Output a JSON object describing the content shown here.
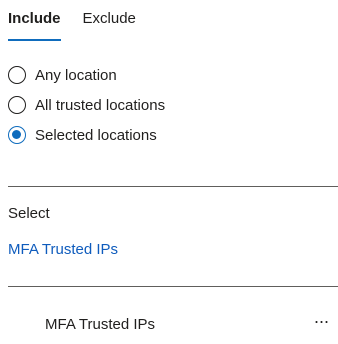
{
  "tabs": [
    {
      "label": "Include",
      "active": true
    },
    {
      "label": "Exclude",
      "active": false
    }
  ],
  "location_options": [
    {
      "label": "Any location",
      "checked": false
    },
    {
      "label": "All trusted locations",
      "checked": false
    },
    {
      "label": "Selected locations",
      "checked": true
    }
  ],
  "select": {
    "label": "Select",
    "link_label": "MFA Trusted IPs"
  },
  "selected_items": [
    {
      "name": "MFA Trusted IPs",
      "more_label": "..."
    }
  ],
  "colors": {
    "accent": "#0f6cbd",
    "text": "#201f1e",
    "divider": "#605e5c"
  }
}
